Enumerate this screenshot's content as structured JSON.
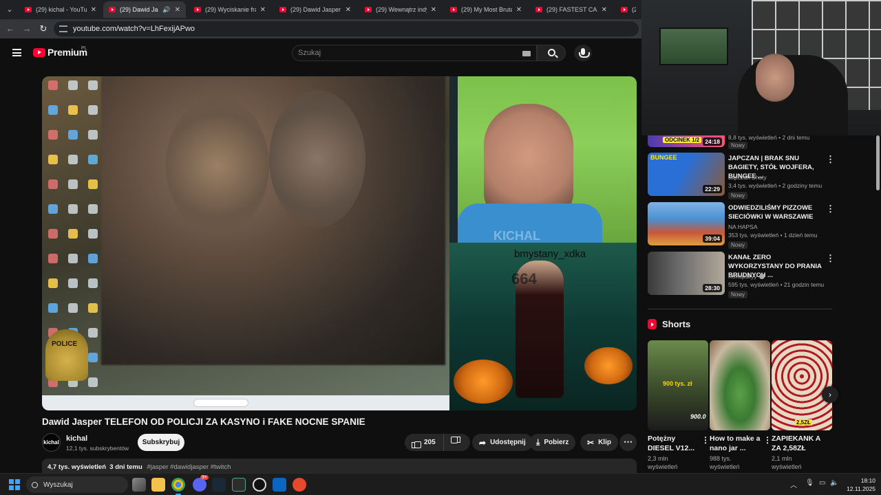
{
  "browser": {
    "tabs": [
      {
        "label": "(29) kichal - YouTube",
        "active": false
      },
      {
        "label": "(29) Dawid Jasper",
        "active": true
      },
      {
        "label": "(29) Wyciskanie franc",
        "active": false
      },
      {
        "label": "(29) Dawid Jasper OM",
        "active": false
      },
      {
        "label": "(29) Wewnątrz indyjs",
        "active": false
      },
      {
        "label": "(29) My Most Brutal V",
        "active": false
      },
      {
        "label": "(29) FASTEST CAR ON",
        "active": false
      },
      {
        "label": "(29) A",
        "active": false
      }
    ],
    "url": "youtube.com/watch?v=LhFexijAPwo"
  },
  "youtube": {
    "logo_text": "Premium",
    "region": "PL",
    "search_placeholder": "Szukaj"
  },
  "player": {
    "desktop_badge_text": "POLICE",
    "channel_watermark": "KICHAL",
    "overlay_user": "bmystany_xdka",
    "overlay_number": "664"
  },
  "video": {
    "title": "Dawid Jasper TELEFON OD POLICJI ZA KASYNO i FAKE NOCNE SPANIE",
    "channel_avatar_text": "kichal",
    "channel_name": "kichal",
    "subscribers": "12,1 tys. subskrybentów",
    "subscribe_label": "Subskrybuj",
    "likes": "205",
    "share_label": "Udostępnij",
    "download_label": "Pobierz",
    "clip_label": "Klip",
    "views_date": "4,7 tys. wyświetleń  3 dni temu",
    "tags": "#jasper #dawidjasper #twitch"
  },
  "sidebar": {
    "partial": {
      "thumb_text": "ODCINEK 1/2",
      "duration": "24:18",
      "meta": "8,8 tys. wyświetleń • 2 dni temu",
      "badge": "Nowy"
    },
    "recommendations": [
      {
        "title": "JAPCZAN | BRAK SNU BAGIETY, STÓŁ WOJFERA, BUNGEE ...",
        "channel": "Japczan Shoty",
        "verified": false,
        "meta": "3,4 tys. wyświetleń • 2 godziny temu",
        "duration": "22:29",
        "badge": "Nowy",
        "thumb_text": "BUNGEE",
        "thumb_colors": [
          "#2a6fd6",
          "#8a5a3a"
        ]
      },
      {
        "title": "ODWIEDZILIŚMY PIZZOWE SIECIÓWKI W WARSZAWIE",
        "channel": "NA HAPSA",
        "verified": false,
        "meta": "353 tys. wyświetleń • 1 dzień temu",
        "duration": "39:04",
        "badge": "Nowy",
        "thumb_text": "",
        "thumb_colors": [
          "#4a8fd0",
          "#c8563a"
        ]
      },
      {
        "title": "KANAŁ ZERO WYKORZYSTANY DO PRANIA BRUDNYCH ...",
        "channel": "Konopskyy",
        "verified": true,
        "meta": "595 tys. wyświetleń • 21 godzin temu",
        "duration": "28:30",
        "badge": "Nowy",
        "thumb_text": "",
        "thumb_colors": [
          "#3a3a3a",
          "#b0a89a"
        ]
      }
    ],
    "shorts_title": "Shorts",
    "shorts": [
      {
        "title": "Potężny DIESEL V12...",
        "views": "2,3 mln wyświetleń",
        "overlay": "900 tys. zł",
        "overlay2": "900.0",
        "colors": [
          "#4e6a3a",
          "#1f2b1a"
        ]
      },
      {
        "title": "How to make a nano jar ...",
        "views": "988 tys. wyświetleń",
        "overlay": "",
        "overlay2": "",
        "colors": [
          "#d8c7b0",
          "#4a8a3a"
        ]
      },
      {
        "title": "ZAPIEKANK A ZA 2,58ZŁ",
        "views": "2,1 mln wyświetleń",
        "overlay": "2,5ZŁ",
        "overlay2": "",
        "colors": [
          "#e8d8c0",
          "#b02030"
        ]
      }
    ]
  },
  "taskbar": {
    "search_label": "Wyszukaj",
    "time": "18:10",
    "date": "12.11.2025",
    "discord_badge": "9+"
  }
}
